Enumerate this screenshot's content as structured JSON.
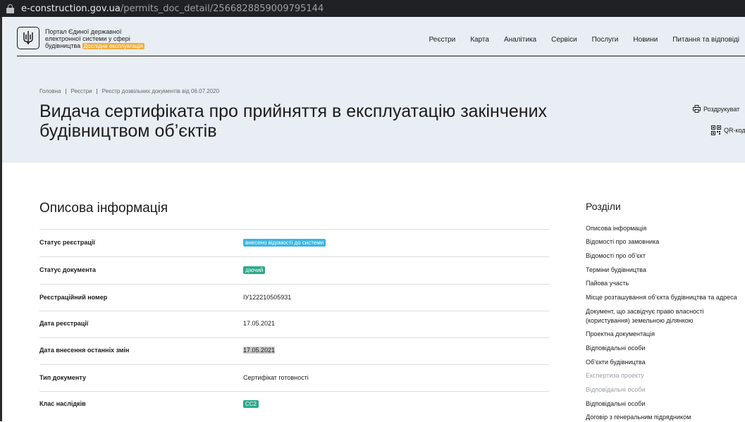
{
  "browser": {
    "url_host": "e-construction.gov.ua",
    "url_path": "/permits_doc_detail/2566828859009795144"
  },
  "header": {
    "portal_line1": "Портал Єдиної державної",
    "portal_line2": "електронної системи у сфері",
    "portal_line3": "будівництва",
    "badge": "Дослідна експлуатація",
    "menu": [
      "Реєстри",
      "Карта",
      "Аналітика",
      "Сервіси",
      "Послуги",
      "Новини",
      "Питання та відповіді"
    ],
    "breadcrumb": [
      "Головна",
      "Реєстри",
      "Реєстр дозвільних документів від 06.07.2020"
    ],
    "title_line1": "Видача сертифіката про прийняття в експлуатацію закінчених",
    "title_line2": "будівництвом об’єктів",
    "print_label": "Роздрукуват",
    "qr_label": "QR-код"
  },
  "main": {
    "section_title": "Описова інформація",
    "rows": [
      {
        "label": "Статус реєстрації",
        "value": "внесено відомості до системи"
      },
      {
        "label": "Статус документа",
        "value": "діючий"
      },
      {
        "label": "Реєстраційний номер",
        "value": "ІУ122210505931"
      },
      {
        "label": "Дата реєстрації",
        "value": "17.05.2021"
      },
      {
        "label": "Дата внесення останніх змін",
        "value": "17.05.2021"
      },
      {
        "label": "Тип документу",
        "value": "Сертифікат готовності"
      },
      {
        "label": "Клас наслідків",
        "value": "СС2"
      }
    ]
  },
  "sections": {
    "title": "Розділи",
    "items": [
      "Описова інформація",
      "Відомості про замовника",
      "Відомості про об’єкт",
      "Терміни будівництва",
      "Пайова участь",
      "Місце розташування об’єкта будівництва та адреса",
      "Документ, що засвідчує право власності",
      "(користування) земельною ділянкою",
      "Проектна документація",
      "Відповідальні особи",
      "Об’єкти будівництва",
      "Експертиза проекту",
      "Відповідальні особи",
      "Відповідальні особи",
      "Договір з генеральним підрядником"
    ]
  },
  "colors": {
    "header_bg": "#e8eef3",
    "tag_blue": "#3ab5e0",
    "tag_green": "#2aa98b",
    "badge_orange": "#f0ad3c"
  }
}
